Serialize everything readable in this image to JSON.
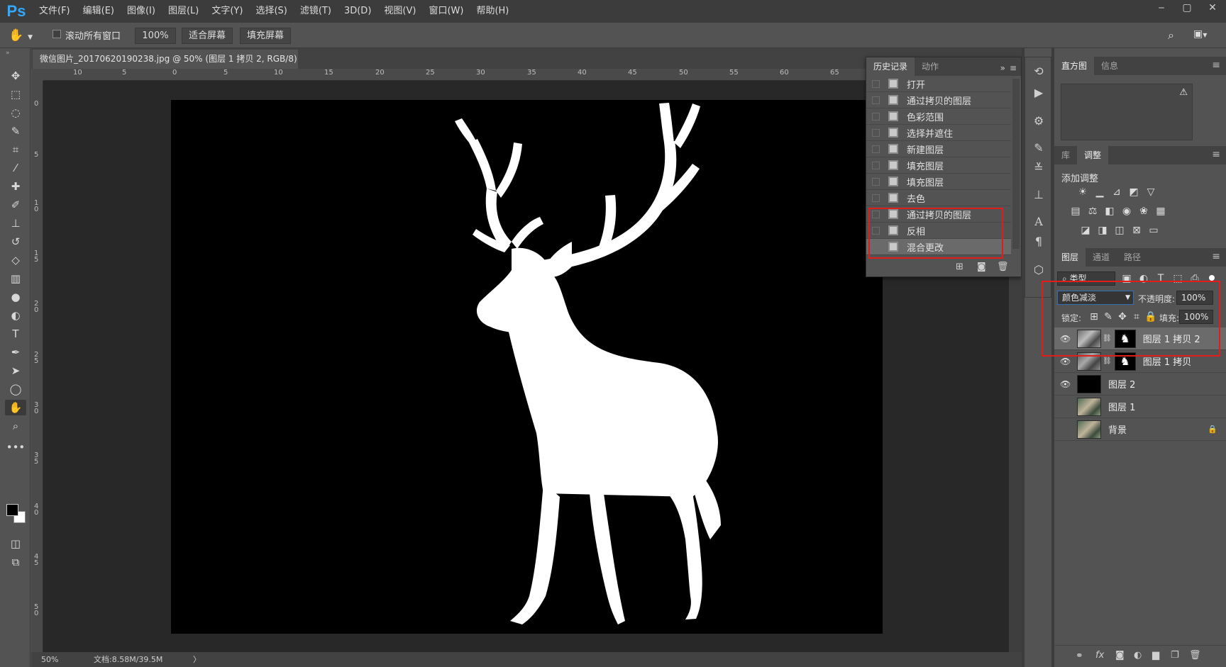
{
  "app": {
    "logo": "Ps"
  },
  "menu": [
    "文件(F)",
    "编辑(E)",
    "图像(I)",
    "图层(L)",
    "文字(Y)",
    "选择(S)",
    "滤镜(T)",
    "3D(D)",
    "视图(V)",
    "窗口(W)",
    "帮助(H)"
  ],
  "window_controls": {
    "minimize": "‒",
    "maximize": "▢",
    "close": "✕"
  },
  "options": {
    "scroll_all_label": "滚动所有窗口",
    "zoom_value": "100%",
    "fit_screen": "适合屏幕",
    "fill_screen": "填充屏幕"
  },
  "document": {
    "tab_title": "微信图片_20170620190238.jpg @ 50% (图层 1 拷贝 2, RGB/8) *",
    "tab_close": "×",
    "zoom": "50%",
    "doc_info": "文档:8.58M/39.5M",
    "status_arrow": "〉"
  },
  "ruler_h": [
    "10",
    "5",
    "0",
    "5",
    "10",
    "15",
    "20",
    "25",
    "30",
    "35",
    "40",
    "45",
    "50",
    "55",
    "60",
    "65"
  ],
  "ruler_v": [
    "0",
    "5",
    "1\n0",
    "1\n5",
    "2\n0",
    "2\n5",
    "3\n0",
    "3\n5",
    "4\n0",
    "4\n5",
    "5\n0"
  ],
  "history": {
    "tabs": [
      "历史记录",
      "动作"
    ],
    "expand": "»",
    "items": [
      "打开",
      "通过拷贝的图层",
      "色彩范围",
      "选择并遮住",
      "新建图层",
      "填充图层",
      "填充图层",
      "去色",
      "通过拷贝的图层",
      "反相",
      "混合更改"
    ],
    "selected_index": 10
  },
  "right_panels": {
    "top_tabs": [
      "直方图",
      "信息"
    ],
    "warning_icon": "⚠",
    "mid_tabs": [
      "库",
      "调整"
    ],
    "add_adjustment": "添加调整",
    "layer_tabs": [
      "图层",
      "通道",
      "路径"
    ]
  },
  "layers": {
    "filter_kind": "类型",
    "blend_mode": "颜色减淡",
    "opacity_label": "不透明度:",
    "opacity_value": "100%",
    "lock_label": "锁定:",
    "fill_label": "填充:",
    "fill_value": "100%",
    "items": [
      {
        "name": "图层 1 拷贝 2",
        "visible": true,
        "selected": true,
        "has_mask": true,
        "thumb": "photo"
      },
      {
        "name": "图层 1 拷贝",
        "visible": true,
        "selected": false,
        "has_mask": true,
        "thumb": "photo"
      },
      {
        "name": "图层 2",
        "visible": true,
        "selected": false,
        "has_mask": false,
        "thumb": "black"
      },
      {
        "name": "图层 1",
        "visible": false,
        "selected": false,
        "has_mask": false,
        "thumb": "photo"
      },
      {
        "name": "背景",
        "visible": false,
        "selected": false,
        "has_mask": false,
        "thumb": "photo",
        "locked": true
      }
    ],
    "bottom_icons": [
      "⚭",
      "fx",
      "◙",
      "◐",
      "▆",
      "❐",
      "🗑"
    ]
  },
  "colors": {
    "highlight_box": "#e21b1b",
    "ps_blue": "#31a8ff"
  }
}
